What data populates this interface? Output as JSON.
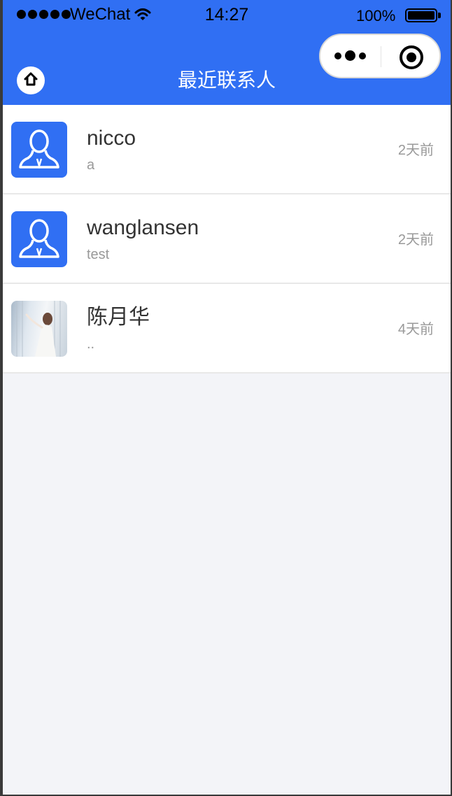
{
  "status_bar": {
    "carrier": "WeChat",
    "time": "14:27",
    "battery": "100%"
  },
  "nav": {
    "title": "最近联系人"
  },
  "icons": {
    "home": "home-icon",
    "more": "more-dots-icon",
    "close": "close-miniprogram-icon",
    "wifi": "wifi-icon",
    "battery": "battery-icon",
    "default_avatar": "user-silhouette-icon"
  },
  "colors": {
    "brand": "#306ff3",
    "background": "#f3f4f8",
    "name_text": "#333333",
    "secondary_text": "#999999"
  },
  "contacts": [
    {
      "name": "nicco",
      "last_message": "a",
      "time": "2天前",
      "avatar": "default"
    },
    {
      "name": "wanglansen",
      "last_message": "test",
      "time": "2天前",
      "avatar": "default"
    },
    {
      "name": "陈月华",
      "last_message": "..",
      "time": "4天前",
      "avatar": "photo"
    }
  ]
}
